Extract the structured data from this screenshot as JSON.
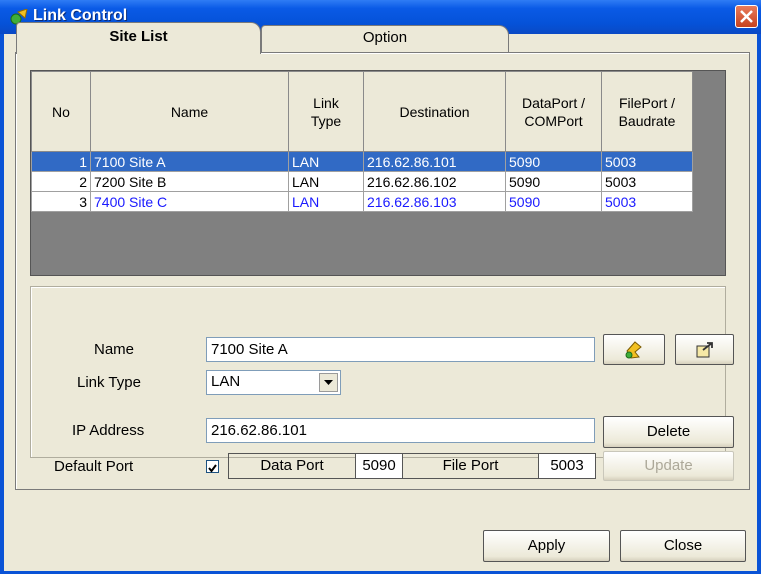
{
  "window": {
    "title": "Link Control"
  },
  "tabs": [
    {
      "label": "Site List",
      "active": true
    },
    {
      "label": "Option",
      "active": false
    }
  ],
  "table": {
    "headers": [
      "No",
      "Name",
      "Link\nType",
      "Destination",
      "DataPort /\nCOMPort",
      "FilePort /\nBaudrate"
    ],
    "rows": [
      {
        "no": "1",
        "name": "7100 Site A",
        "link_type": "LAN",
        "destination": "216.62.86.101",
        "data_port": "5090",
        "file_port": "5003",
        "selected": true
      },
      {
        "no": "2",
        "name": "7200 Site B",
        "link_type": "LAN",
        "destination": "216.62.86.102",
        "data_port": "5090",
        "file_port": "5003"
      },
      {
        "no": "3",
        "name": "7400 Site C",
        "link_type": "LAN",
        "destination": "216.62.86.103",
        "data_port": "5090",
        "file_port": "5003",
        "color": "#1a1aff"
      }
    ]
  },
  "form": {
    "name_label": "Name",
    "name_value": "7100 Site A",
    "link_type_label": "Link Type",
    "link_type_value": "LAN",
    "ip_label": "IP Address",
    "ip_value": "216.62.86.101",
    "default_port_label": "Default Port",
    "default_port_checked": true,
    "data_port_label": "Data Port",
    "data_port_value": "5090",
    "file_port_label": "File Port",
    "file_port_value": "5003",
    "delete_label": "Delete",
    "update_label": "Update",
    "icon_button_1": "connect-icon",
    "icon_button_2": "export-icon"
  },
  "footer": {
    "apply_label": "Apply",
    "close_label": "Close"
  },
  "colors": {
    "selection": "#316ac5",
    "title_bar": "#0a5ae6",
    "highlight_text": "#1a1aff"
  }
}
